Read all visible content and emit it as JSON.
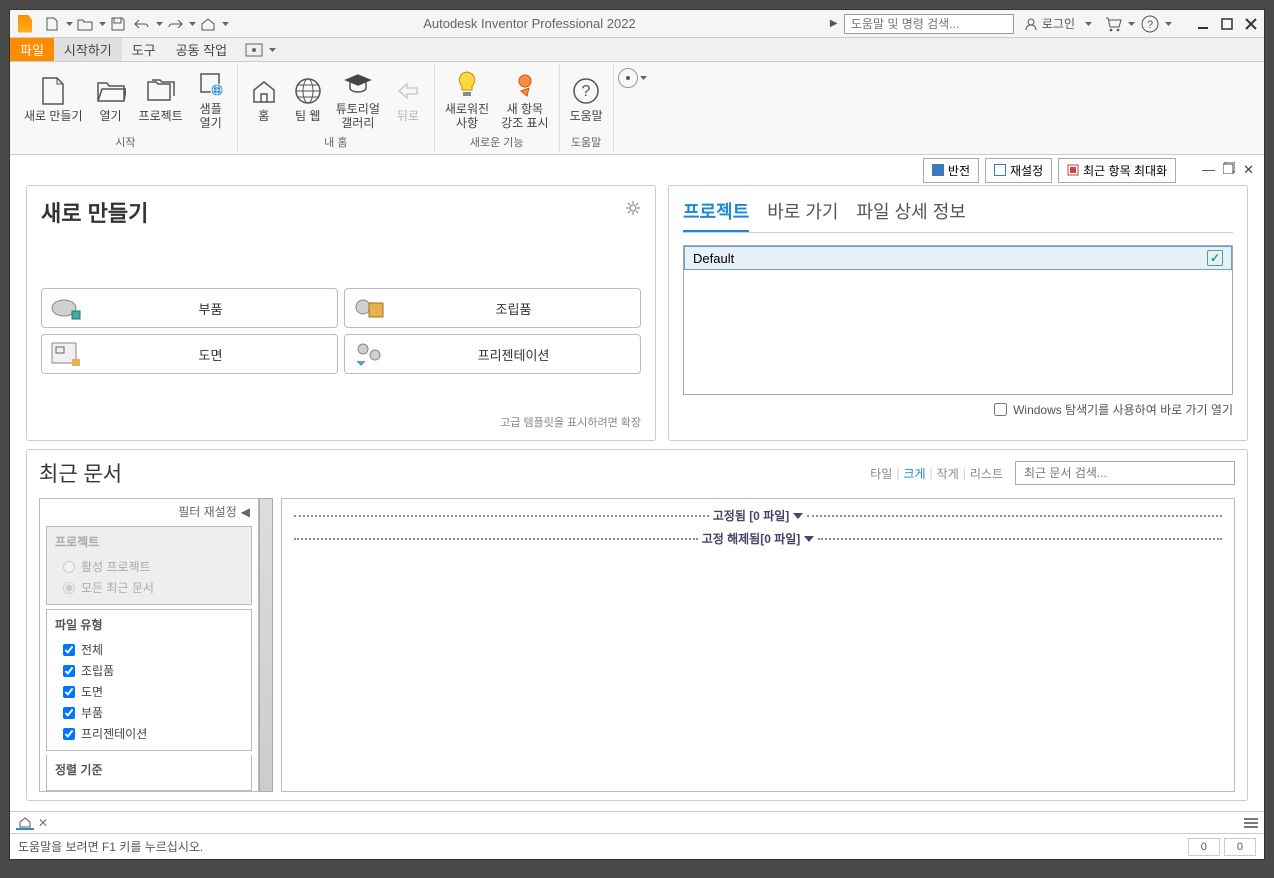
{
  "titlebar": {
    "app_title": "Autodesk Inventor Professional 2022",
    "search_placeholder": "도움말 및 명령 검색...",
    "login_label": "로그인"
  },
  "ribbon_tabs": {
    "t0": "파일",
    "t1": "시작하기",
    "t2": "도구",
    "t3": "공동 작업"
  },
  "ribbon": {
    "panel_start": {
      "title": "시작",
      "new": "새로 만들기",
      "open": "열기",
      "projects": "프로젝트",
      "sample_open": "샘플\n열기"
    },
    "panel_home": {
      "title": "내 홈",
      "home": "홈",
      "team_web": "팀 웹",
      "tutorial": "튜토리얼\n갤러리",
      "back": "뒤로"
    },
    "panel_new": {
      "title": "새로운 기능",
      "whats_new": "새로워진\n사항",
      "highlight": "새 항목\n강조 표시"
    },
    "panel_help": {
      "title": "도움말",
      "help": "도움말"
    }
  },
  "workspace_bar": {
    "invert": "반전",
    "reset": "재설정",
    "maximize": "최근 항목 최대화"
  },
  "new_panel": {
    "title": "새로 만들기",
    "part": "부품",
    "assembly": "조립품",
    "drawing": "도면",
    "presentation": "프리젠테이션",
    "hint": "고급 템플릿을 표시하려면 확장"
  },
  "project_panel": {
    "tab_projects": "프로젝트",
    "tab_shortcuts": "바로 가기",
    "tab_details": "파일 상세 정보",
    "default_item": "Default",
    "explorer_label": "Windows 탐색기를 사용하여 바로 가기 열기"
  },
  "recent": {
    "title": "최근 문서",
    "view_tile": "타일",
    "view_large": "크게",
    "view_small": "작게",
    "view_list": "리스트",
    "search_placeholder": "최근 문서 검색...",
    "filter_reset": "필터 재설정",
    "grp_project": "프로젝트",
    "opt_active": "활성 프로젝트",
    "opt_all_recent": "모든 최근 문서",
    "grp_filetype": "파일 유형",
    "opt_all": "전체",
    "opt_assembly": "조립품",
    "opt_drawing": "도면",
    "opt_part": "부품",
    "opt_presentation": "프리젠테이션",
    "grp_sort": "정렬 기준",
    "pinned_label": "고정됨 [0 파일]",
    "unpinned_label": "고정 해제됨[0 파일]"
  },
  "status": {
    "help_msg": "도움말을 보려면 F1 키를 누르십시오.",
    "count1": "0",
    "count2": "0"
  }
}
